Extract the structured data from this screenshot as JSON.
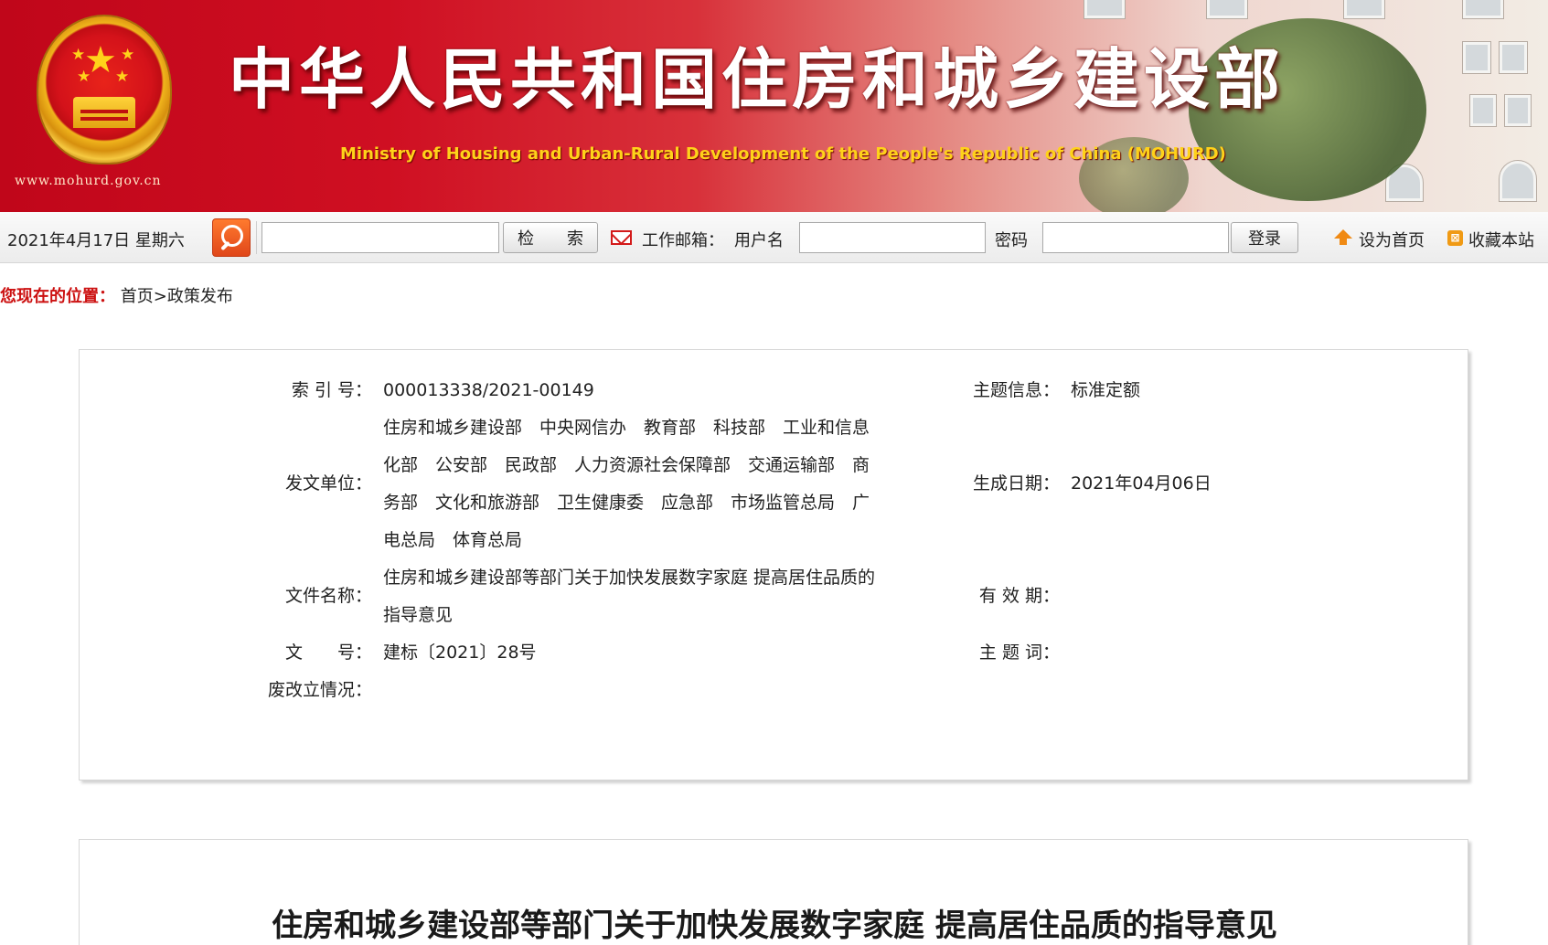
{
  "banner": {
    "site_url": "www.mohurd.gov.cn",
    "title_cn": "中华人民共和国住房和城乡建设部",
    "title_en": "Ministry of Housing and Urban-Rural Development of the People's Republic of China (MOHURD)",
    "colors": {
      "banner_red": "#c0061a",
      "title_en_yellow": "#ffd21a"
    }
  },
  "toolbar": {
    "date": "2021年4月17日 星期六",
    "search_placeholder": "",
    "search_label": "检　　索",
    "mail_label": "工作邮箱：",
    "username_label": "用户名",
    "password_label": "密码",
    "login_label": "登录",
    "set_home_label": "设为首页",
    "favorite_label": "收藏本站"
  },
  "breadcrumb": {
    "prefix": "您现在的位置：",
    "home": "首页",
    "separator": ">",
    "current": "政策发布"
  },
  "info": {
    "index_no": {
      "label": "索 引 号：",
      "value": "000013338/2021-00149"
    },
    "topic": {
      "label": "主题信息：",
      "value": "标准定额"
    },
    "issuer": {
      "label": "发文单位：",
      "value": "住房和城乡建设部　中央网信办　教育部　科技部　工业和信息化部　公安部　民政部　人力资源社会保障部　交通运输部　商务部　文化和旅游部　卫生健康委　应急部　市场监管总局　广电总局　体育总局"
    },
    "gen_date": {
      "label": "生成日期：",
      "value": "2021年04月06日"
    },
    "doc_name": {
      "label": "文件名称：",
      "value": "住房和城乡建设部等部门关于加快发展数字家庭 提高居住品质的指导意见"
    },
    "validity": {
      "label": "有 效 期：",
      "value": ""
    },
    "doc_no": {
      "label": "文　　号：",
      "value": "建标〔2021〕28号"
    },
    "keywords": {
      "label": "主 题 词：",
      "value": ""
    },
    "status": {
      "label": "废改立情况：",
      "value": ""
    }
  },
  "article": {
    "title": "住房和城乡建设部等部门关于加快发展数字家庭 提高居住品质的指导意见"
  }
}
